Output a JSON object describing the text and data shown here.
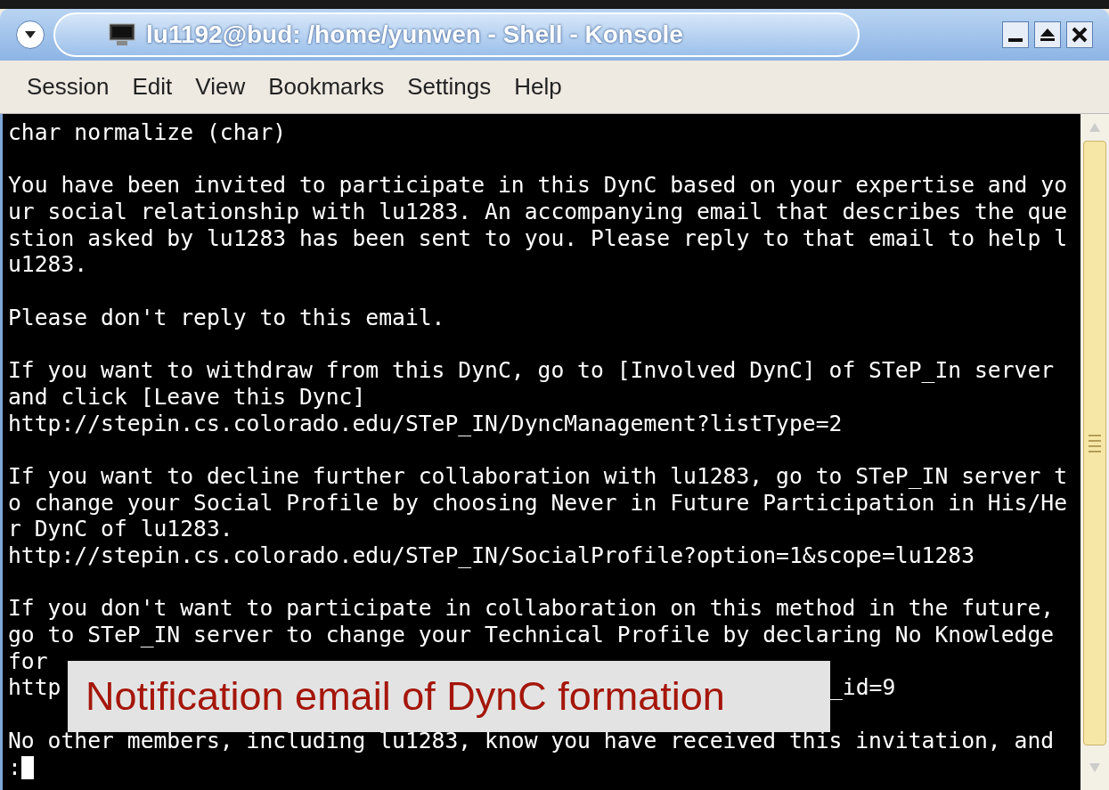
{
  "window": {
    "title": "lu1192@bud: /home/yunwen - Shell - Konsole"
  },
  "menu": [
    {
      "label": "Session"
    },
    {
      "label": "Edit"
    },
    {
      "label": "View"
    },
    {
      "label": "Bookmarks"
    },
    {
      "label": "Settings"
    },
    {
      "label": "Help"
    }
  ],
  "terminal": {
    "paragraphs": [
      {
        "lines": [
          {
            "text": "char normalize (char)"
          }
        ]
      },
      {
        "lines": [
          {
            "text": "You have been invited to participate in this DynC based on your expertise and yo"
          },
          {
            "text": "ur social relationship with lu1283. An accompanying email that describes the que"
          },
          {
            "text": "stion asked by lu1283 has been sent to you. Please reply to that email to help l"
          },
          {
            "text": "u1283."
          }
        ]
      },
      {
        "lines": [
          {
            "text": "Please don't reply to this email."
          }
        ]
      },
      {
        "lines": [
          {
            "text": "If you want to withdraw from this DynC, go to [Involved DynC] of STeP_In server"
          },
          {
            "text": "and click [Leave this Dync]"
          },
          {
            "text": "http://stepin.cs.colorado.edu/STeP_IN/DyncManagement?listType=2"
          }
        ]
      },
      {
        "lines": [
          {
            "text": "If you want to decline further collaboration with lu1283, go to STeP_IN server t"
          },
          {
            "text": "o change your Social Profile by choosing Never in Future Participation in His/He"
          },
          {
            "text": "r DynC of lu1283."
          },
          {
            "text": "http://stepin.cs.colorado.edu/STeP_IN/SocialProfile?option=1&scope=lu1283"
          }
        ]
      },
      {
        "lines": [
          {
            "text": "If you don't want to participate in collaboration on this method in the future,"
          },
          {
            "text": "go to STeP_IN server to change your Technical Profile by declaring No Knowledge"
          },
          {
            "text": "for"
          },
          {
            "text": "http",
            "tail": "_id=9"
          }
        ]
      },
      {
        "lines": [
          {
            "text": "No other members, including lu1283, know you have received this invitation, and"
          },
          {
            "text": ":",
            "cursor": true
          }
        ]
      }
    ]
  },
  "caption": "Notification email of DynC formation"
}
